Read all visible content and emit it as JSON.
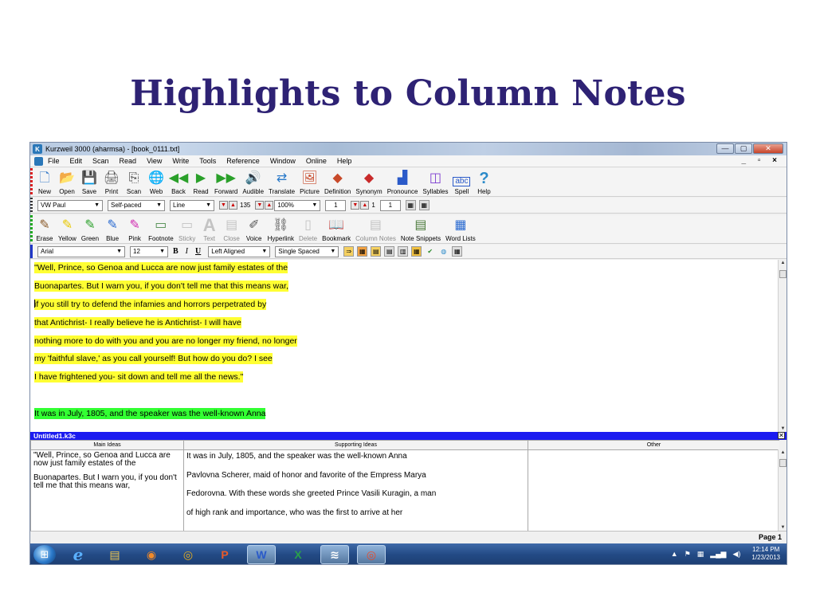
{
  "slide": {
    "title": "Highlights to Column Notes"
  },
  "window": {
    "title": "Kurzweil 3000 (aharmsa) - [book_0111.txt]",
    "buttons": {
      "minimize": "—",
      "maximize": "▢",
      "close": "✕"
    }
  },
  "menu": {
    "items": [
      "File",
      "Edit",
      "Scan",
      "Read",
      "View",
      "Write",
      "Tools",
      "Reference",
      "Window",
      "Online",
      "Help"
    ],
    "mdi_controls": "_ ▫ ×"
  },
  "toolbar_main": {
    "items": [
      {
        "label": "New",
        "icon": "new-doc-icon",
        "glyph": "🗋",
        "color": "#3a7cc9"
      },
      {
        "label": "Open",
        "icon": "open-icon",
        "glyph": "📂",
        "color": "#d8a820"
      },
      {
        "label": "Save",
        "icon": "save-icon",
        "glyph": "💾",
        "color": "#3a7cc9"
      },
      {
        "label": "Print",
        "icon": "print-icon",
        "glyph": "🖨",
        "color": "#555"
      },
      {
        "label": "Scan",
        "icon": "scan-icon",
        "glyph": "⎘",
        "color": "#444"
      },
      {
        "label": "Web",
        "icon": "web-globe-icon",
        "glyph": "🌐",
        "color": "#2a8a3a"
      },
      {
        "label": "Back",
        "icon": "back-arrow-icon",
        "glyph": "◀◀",
        "color": "#2aa02a"
      },
      {
        "label": "Read",
        "icon": "read-play-icon",
        "glyph": "▶",
        "color": "#2aa02a"
      },
      {
        "label": "Forward",
        "icon": "forward-arrow-icon",
        "glyph": "▶▶",
        "color": "#2aa02a"
      },
      {
        "label": "Audible",
        "icon": "audible-speaker-icon",
        "glyph": "🔊",
        "color": "#7a3ad0"
      },
      {
        "label": "Translate",
        "icon": "translate-icon",
        "glyph": "⇄",
        "color": "#2a7ac9"
      },
      {
        "label": "Picture",
        "icon": "picture-icon",
        "glyph": "🖼",
        "color": "#c84a2a"
      },
      {
        "label": "Definition",
        "icon": "definition-icon",
        "glyph": "◆",
        "color": "#c84a2a"
      },
      {
        "label": "Synonym",
        "icon": "synonym-icon",
        "glyph": "◆",
        "color": "#c82a2a"
      },
      {
        "label": "Pronounce",
        "icon": "pronounce-icon",
        "glyph": "▟",
        "color": "#2a5ac9"
      },
      {
        "label": "Syllables",
        "icon": "syllables-icon",
        "glyph": "◫",
        "color": "#7a3ad0"
      },
      {
        "label": "Spell",
        "icon": "spell-abc-icon",
        "glyph": "abc",
        "color": "#2a5ac9"
      },
      {
        "label": "Help",
        "icon": "help-question-icon",
        "glyph": "?",
        "color": "#2a8ac9"
      }
    ]
  },
  "reading_bar": {
    "voice": "VW Paul",
    "mode": "Self-paced",
    "unit": "Line",
    "speed": "135",
    "volume": "100%",
    "spin_a": "1",
    "spin_b": "1",
    "spin_c": "1"
  },
  "toolbar_study": {
    "items": [
      {
        "label": "Erase",
        "icon": "erase-pen-icon",
        "glyph": "✎",
        "color": "#8a5a2a",
        "disabled": false
      },
      {
        "label": "Yellow",
        "icon": "yellow-highlighter-icon",
        "glyph": "✎",
        "color": "#e8c800",
        "disabled": false
      },
      {
        "label": "Green",
        "icon": "green-highlighter-icon",
        "glyph": "✎",
        "color": "#2aa02a",
        "disabled": false
      },
      {
        "label": "Blue",
        "icon": "blue-highlighter-icon",
        "glyph": "✎",
        "color": "#2a6ad0",
        "disabled": false
      },
      {
        "label": "Pink",
        "icon": "pink-highlighter-icon",
        "glyph": "✎",
        "color": "#d02ab0",
        "disabled": false
      },
      {
        "label": "Footnote",
        "icon": "footnote-icon",
        "glyph": "▭",
        "color": "#4a8a4a",
        "disabled": false
      },
      {
        "label": "Sticky",
        "icon": "sticky-note-icon",
        "glyph": "▭",
        "color": "#888",
        "disabled": true
      },
      {
        "label": "Text",
        "icon": "text-a-icon",
        "glyph": "A",
        "color": "#888",
        "disabled": true
      },
      {
        "label": "Close",
        "icon": "close-note-icon",
        "glyph": "▤",
        "color": "#888",
        "disabled": true
      },
      {
        "label": "Voice",
        "icon": "voice-pen-icon",
        "glyph": "✐",
        "color": "#555",
        "disabled": false
      },
      {
        "label": "Hyperlink",
        "icon": "hyperlink-chain-icon",
        "glyph": "⛓",
        "color": "#555",
        "disabled": false
      },
      {
        "label": "Delete",
        "icon": "delete-bin-icon",
        "glyph": "▯",
        "color": "#888",
        "disabled": true
      },
      {
        "label": "Bookmark",
        "icon": "bookmark-book-icon",
        "glyph": "📖",
        "color": "#2a7ac9",
        "disabled": false
      },
      {
        "label": "Column Notes",
        "icon": "column-notes-icon",
        "glyph": "▤",
        "color": "#888",
        "disabled": true
      },
      {
        "label": "Note Snippets",
        "icon": "note-snippets-icon",
        "glyph": "▤",
        "color": "#4a7a3a",
        "disabled": false
      },
      {
        "label": "Word Lists",
        "icon": "word-lists-icon",
        "glyph": "▦",
        "color": "#2a6ad0",
        "disabled": false
      }
    ]
  },
  "format_bar": {
    "font": "Arial",
    "size": "12",
    "bold": "B",
    "italic": "I",
    "underline": "U",
    "align": "Left Aligned",
    "spacing": "Single Spaced"
  },
  "document": {
    "lines": [
      {
        "text": "\"Well, Prince, so Genoa and Lucca are now just family estates of the",
        "highlight": "yellow"
      },
      {
        "text": "Buonapartes. But I warn you, if you don't tell me that this means war,",
        "highlight": "yellow"
      },
      {
        "text": "if you still try to defend the infamies and horrors perpetrated by",
        "highlight": "yellow"
      },
      {
        "text": "that Antichrist- I really believe he is Antichrist- I will have",
        "highlight": "yellow"
      },
      {
        "text": "nothing more to do with you and you are no longer my friend, no longer",
        "highlight": "yellow"
      },
      {
        "text": "my 'faithful slave,' as you call yourself! But how do you do? I see",
        "highlight": "yellow"
      },
      {
        "text": "I have frightened you- sit down and tell me all the news.\"",
        "highlight": "yellow"
      },
      {
        "text": "",
        "highlight": "none"
      },
      {
        "text": "It was in July, 1805, and the speaker was the well-known Anna",
        "highlight": "green"
      }
    ]
  },
  "notes": {
    "pane_title": "Untitled1.k3c",
    "close": "✕",
    "columns": [
      "Main Ideas",
      "Supporting Ideas",
      "Other"
    ],
    "main_ideas": [
      "\"Well, Prince, so Genoa and Lucca are now just family estates of the",
      "Buonapartes. But I warn you, if you don't tell me that this means war,"
    ],
    "supporting_ideas": [
      "It was in July, 1805, and the speaker was the well-known Anna",
      "Pavlovna Scherer, maid of honor and favorite of the Empress Marya",
      "Fedorovna. With these words she greeted Prince Vasili Kuragin, a man",
      "of high rank and importance, who was the first to arrive at her"
    ]
  },
  "status": {
    "page": "Page 1"
  },
  "taskbar": {
    "apps": [
      {
        "icon": "internet-explorer-icon",
        "glyph": "e",
        "color": "#5ab0ff",
        "active": false
      },
      {
        "icon": "file-explorer-icon",
        "glyph": "▤",
        "color": "#f0c850",
        "active": false
      },
      {
        "icon": "media-player-icon",
        "glyph": "◉",
        "color": "#f08a2a",
        "active": false
      },
      {
        "icon": "chrome-icon",
        "glyph": "◎",
        "color": "#e8b020",
        "active": false
      },
      {
        "icon": "powerpoint-icon",
        "glyph": "P",
        "color": "#e85a2a",
        "active": false
      },
      {
        "icon": "word-icon",
        "glyph": "W",
        "color": "#2a5ac9",
        "active": true
      },
      {
        "icon": "excel-icon",
        "glyph": "X",
        "color": "#2aa04a",
        "active": false
      },
      {
        "icon": "kurzweil-icon",
        "glyph": "≋",
        "color": "#ffffff",
        "active": true
      },
      {
        "icon": "chrome-icon-2",
        "glyph": "◎",
        "color": "#e84a2a",
        "active": true
      }
    ],
    "clock_time": "12:14 PM",
    "clock_date": "1/23/2013"
  }
}
